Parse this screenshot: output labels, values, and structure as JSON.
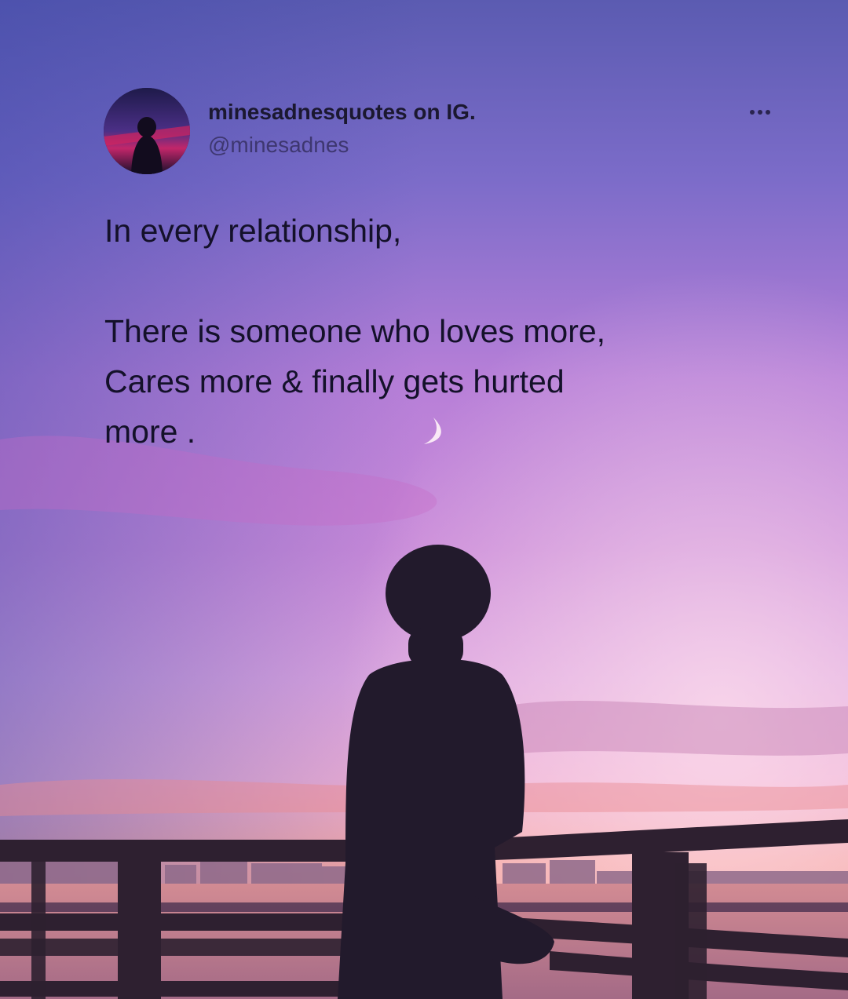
{
  "post": {
    "author": {
      "display_name": "minesadnesquotes on IG.",
      "handle": "@minesadnes"
    },
    "more_menu_icon": "more-horizontal-icon",
    "quote_lines": [
      "In every relationship,",
      "",
      "There is someone who loves more,",
      "Cares more & finally gets hurted",
      "more ."
    ]
  },
  "colors": {
    "sky_top": "#5a5fb4",
    "sky_mid": "#c27ad6",
    "sky_horizon": "#f2a3a8",
    "text": "#14112a"
  }
}
